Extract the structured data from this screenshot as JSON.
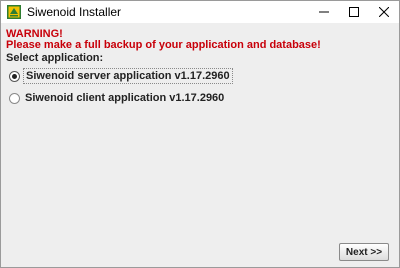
{
  "window": {
    "title": "Siwenoid Installer",
    "icon": "siwenoid-app-icon",
    "controls": [
      "minimize-icon",
      "maximize-icon",
      "close-icon"
    ]
  },
  "content": {
    "warning_title": "WARNING!",
    "warning_message": "Please make a full backup of your application and database!",
    "select_label": "Select application:",
    "options": [
      {
        "label": "Siwenoid server application v1.17.2960",
        "selected": true
      },
      {
        "label": "Siwenoid client application v1.17.2960",
        "selected": false
      }
    ]
  },
  "footer": {
    "next_label": "Next >>"
  },
  "colors": {
    "warning": "#c8000a",
    "background": "#eeeeee",
    "icon_green": "#2e7d32",
    "icon_yellow": "#f2c200"
  }
}
